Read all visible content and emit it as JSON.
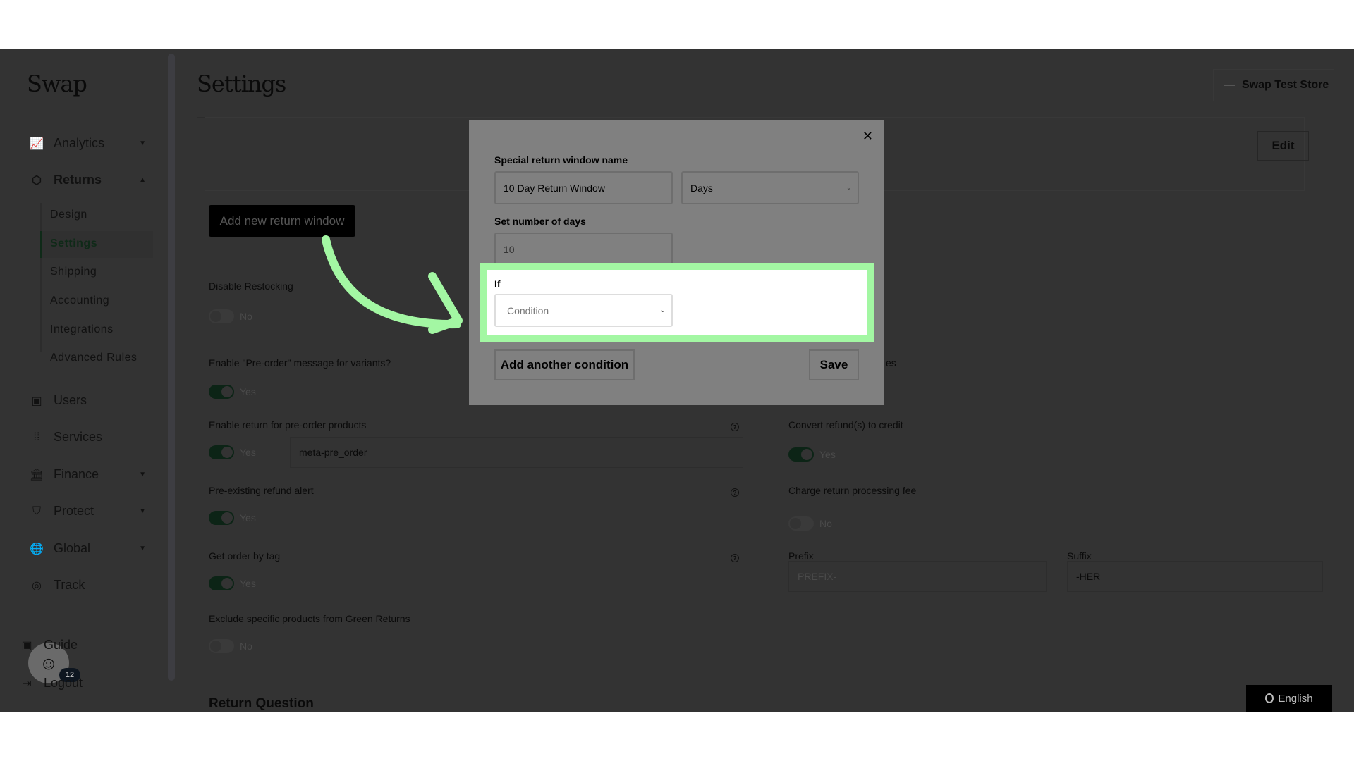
{
  "sidebar": {
    "logo": "Swap",
    "items": [
      {
        "label": "Analytics",
        "icon": "chart-icon"
      },
      {
        "label": "Returns",
        "icon": "box-icon"
      },
      {
        "label": "Users",
        "icon": "user-card-icon"
      },
      {
        "label": "Services",
        "icon": "grid-icon"
      },
      {
        "label": "Finance",
        "icon": "bank-icon"
      },
      {
        "label": "Protect",
        "icon": "shield-icon"
      },
      {
        "label": "Global",
        "icon": "globe-icon"
      },
      {
        "label": "Track",
        "icon": "track-icon"
      }
    ],
    "returns_sub": [
      "Design",
      "Settings",
      "Shipping",
      "Accounting",
      "Integrations",
      "Advanced Rules"
    ],
    "footer": {
      "guide": "Guide",
      "logout": "Logout"
    },
    "chat_badge": "12"
  },
  "header": {
    "title": "Settings",
    "store": "Swap Test Store",
    "edit": "Edit"
  },
  "main": {
    "add_window": "Add new return window",
    "left": [
      {
        "label": "Disable Restocking",
        "value": "No",
        "on": false
      },
      {
        "label": "Enable \"Pre-order\" message for variants?",
        "value": "Yes",
        "on": true
      },
      {
        "label": "Enable return for pre-order products",
        "value": "Yes",
        "on": true,
        "input": "meta-pre_order"
      },
      {
        "label": "Pre-existing refund alert",
        "value": "Yes",
        "on": true
      },
      {
        "label": "Get order by tag",
        "value": "Yes",
        "on": true
      },
      {
        "label": "Exclude specific products from Green Returns",
        "value": "No",
        "on": false
      }
    ],
    "right_partial": "es",
    "right": [
      {
        "label": "Convert refund(s) to credit",
        "value": "Yes",
        "on": true
      },
      {
        "label": "Charge return processing fee",
        "value": "No",
        "on": false
      }
    ],
    "prefix": {
      "label": "Prefix",
      "placeholder": "PREFIX-"
    },
    "suffix": {
      "label": "Suffix",
      "value": "-HER"
    },
    "section": "Return Question",
    "language": "English"
  },
  "modal": {
    "name_label": "Special return window name",
    "name_value": "10 Day Return Window",
    "unit": "Days",
    "days_label": "Set number of days",
    "days_value": "10",
    "if_label": "If",
    "condition_placeholder": "Condition",
    "add_condition": "Add another condition",
    "save": "Save"
  },
  "highlight_color": "#a3f7a3"
}
